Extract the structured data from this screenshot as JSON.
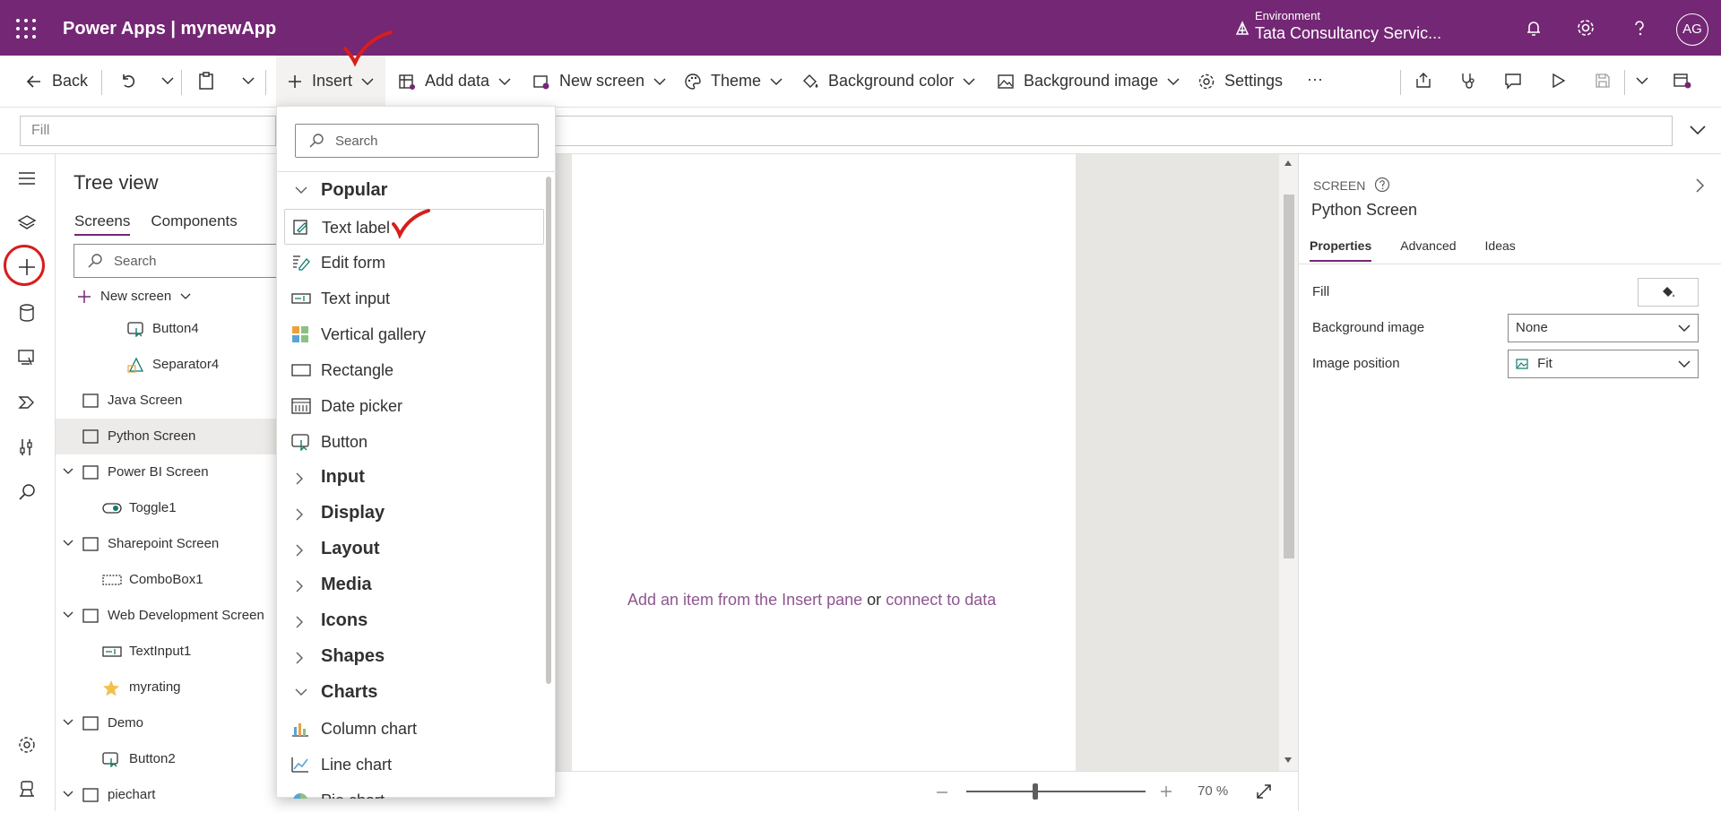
{
  "app": {
    "title": "Power Apps  |  mynewApp"
  },
  "environment": {
    "label": "Environment",
    "value": "Tata Consultancy Servic..."
  },
  "user": {
    "initials": "AG"
  },
  "toolbar": {
    "back": "Back",
    "insert": "Insert",
    "add_data": "Add data",
    "new_screen": "New screen",
    "theme": "Theme",
    "background_color": "Background color",
    "background_image": "Background image",
    "settings": "Settings",
    "more": "···"
  },
  "formula_bar": {
    "property": "Fill"
  },
  "tree_view": {
    "title": "Tree view",
    "tabs": [
      "Screens",
      "Components"
    ],
    "search_placeholder": "Search",
    "new_screen": "New screen",
    "nodes": [
      {
        "label": "Button4",
        "icon": "button-icon"
      },
      {
        "label": "Separator4",
        "icon": "separator-icon"
      },
      {
        "label": "Java Screen",
        "icon": "screen-icon"
      },
      {
        "label": "Python Screen",
        "icon": "screen-icon",
        "selected": true
      },
      {
        "label": "Power BI Screen",
        "icon": "screen-icon"
      },
      {
        "label": "Toggle1",
        "icon": "toggle-icon"
      },
      {
        "label": "Sharepoint Screen",
        "icon": "screen-icon"
      },
      {
        "label": "ComboBox1",
        "icon": "combobox-icon"
      },
      {
        "label": "Web Development Screen",
        "icon": "screen-icon"
      },
      {
        "label": "TextInput1",
        "icon": "text-input-icon"
      },
      {
        "label": "myrating",
        "icon": "star-icon"
      },
      {
        "label": "Demo",
        "icon": "screen-icon"
      },
      {
        "label": "Button2",
        "icon": "button-icon"
      },
      {
        "label": "piechart",
        "icon": "screen-icon"
      }
    ]
  },
  "insert_pane": {
    "search_placeholder": "Search",
    "popular": "Popular",
    "items": [
      "Text label",
      "Edit form",
      "Text input",
      "Vertical gallery",
      "Rectangle",
      "Date picker",
      "Button"
    ],
    "categories": [
      "Input",
      "Display",
      "Layout",
      "Media",
      "Icons",
      "Shapes"
    ],
    "charts": "Charts",
    "chart_items": [
      "Column chart",
      "Line chart",
      "Pie chart"
    ]
  },
  "canvas": {
    "hint_link": "Add an item from the Insert pane",
    "hint_or": "or",
    "hint_link2": "connect to data"
  },
  "zoom": {
    "value": "70",
    "unit": "%"
  },
  "properties": {
    "kind": "SCREEN",
    "name": "Python Screen",
    "tabs": [
      "Properties",
      "Advanced",
      "Ideas"
    ],
    "fill_label": "Fill",
    "bg_image_label": "Background image",
    "bg_image_value": "None",
    "image_pos_label": "Image position",
    "image_pos_value": "Fit"
  },
  "colors": {
    "brand": "#742774",
    "annotation": "#d71d1d",
    "link": "#8e5690"
  }
}
